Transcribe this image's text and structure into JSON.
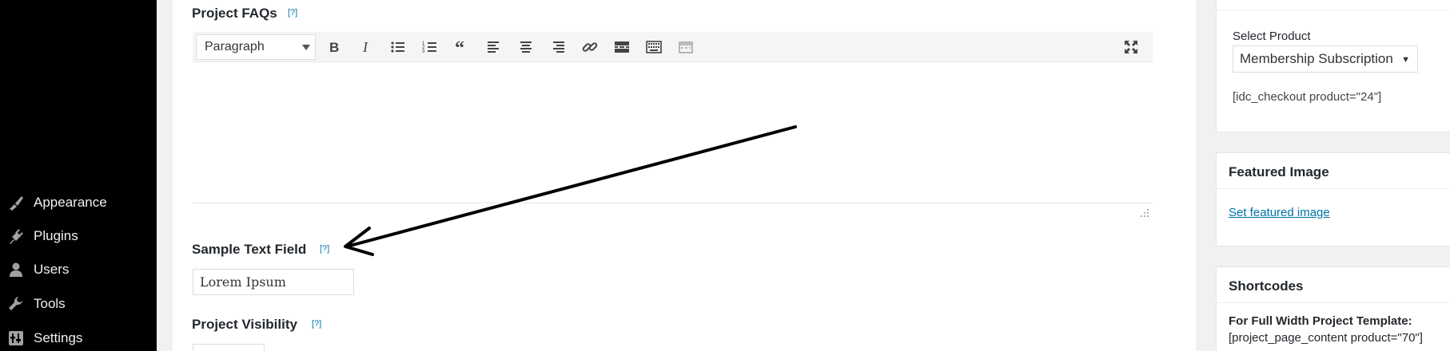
{
  "sidebar": {
    "items": [
      {
        "label": "Appearance",
        "icon": "paintbrush-icon"
      },
      {
        "label": "Plugins",
        "icon": "plugin-icon"
      },
      {
        "label": "Users",
        "icon": "user-icon"
      },
      {
        "label": "Tools",
        "icon": "wrench-icon"
      },
      {
        "label": "Settings",
        "icon": "settings-icon"
      }
    ]
  },
  "main": {
    "faqs": {
      "title": "Project FAQs",
      "help": "[?]",
      "format_select": "Paragraph",
      "toolbar_icons": [
        "bold-icon",
        "italic-icon",
        "bullet-list-icon",
        "numbered-list-icon",
        "blockquote-icon",
        "align-left-icon",
        "align-center-icon",
        "align-right-icon",
        "link-icon",
        "read-more-icon",
        "keyboard-icon",
        "toolbar-toggle-icon",
        "fullscreen-icon"
      ]
    },
    "sample": {
      "title": "Sample Text Field",
      "help": "[?]",
      "value": "Lorem Ipsum"
    },
    "visibility": {
      "title": "Project Visibility",
      "help": "[?]"
    }
  },
  "right": {
    "product": {
      "label": "Select Product",
      "selected": "Membership Subscription",
      "shortcode": "[idc_checkout product=\"24\"]"
    },
    "featured": {
      "title": "Featured Image",
      "link": "Set featured image"
    },
    "shortcodes": {
      "title": "Shortcodes",
      "subtitle": "For Full Width Project Template:",
      "code": "[project_page_content product=\"70\"]"
    }
  },
  "colors": {
    "sidebar_bg": "#000000",
    "link": "#0073aa",
    "page_bg": "#f1f1f1"
  }
}
